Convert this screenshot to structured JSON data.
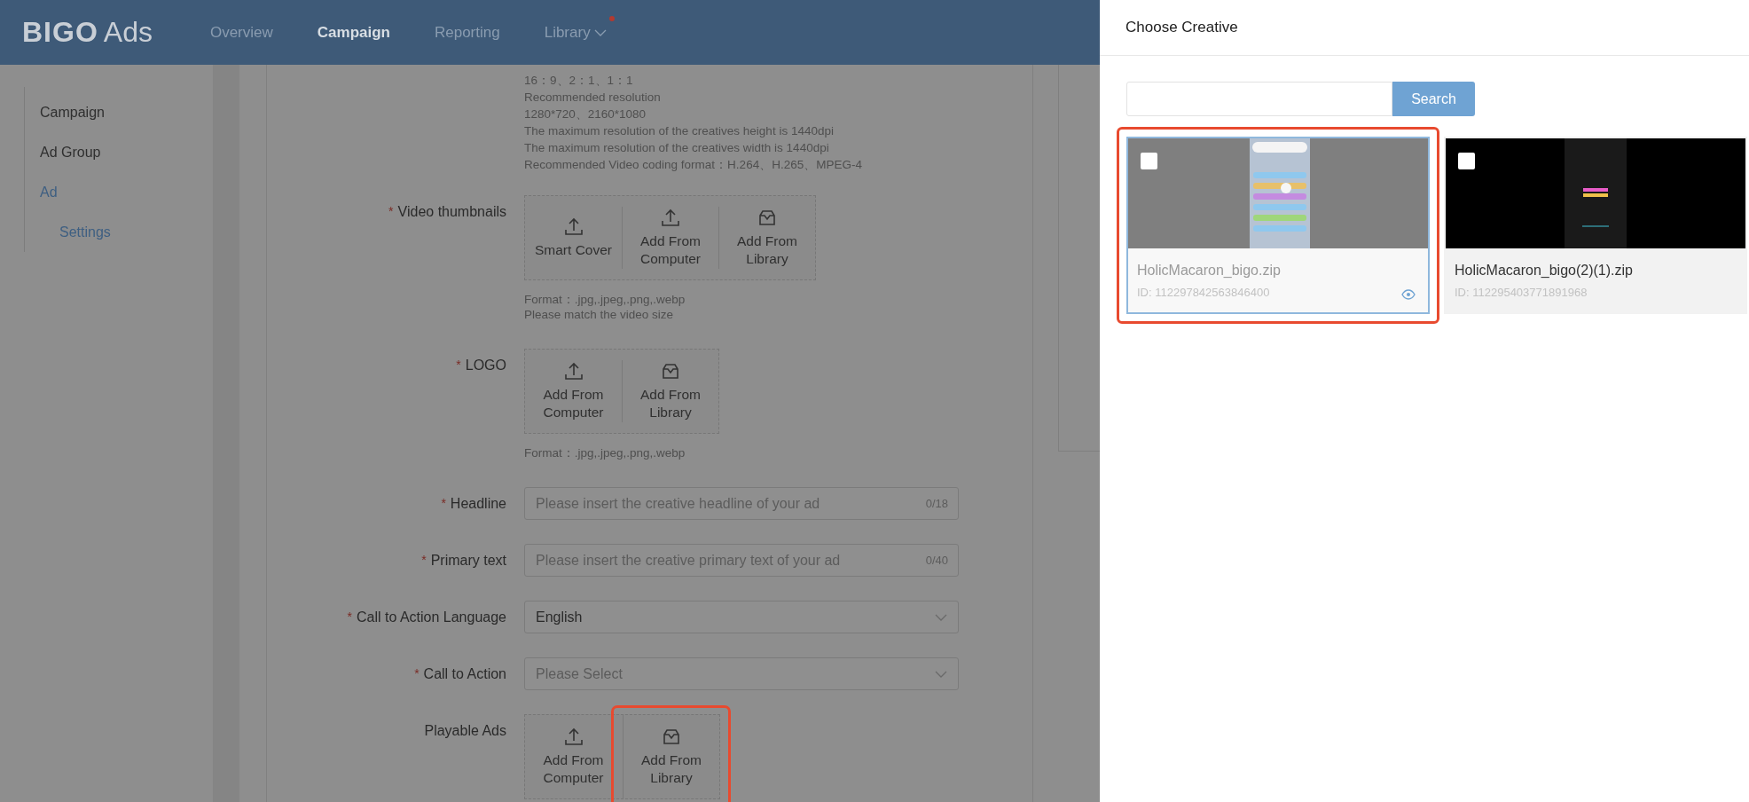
{
  "header": {
    "logo_mark": "BIGO",
    "logo_text": "Ads",
    "nav": [
      {
        "label": "Overview",
        "selected": false,
        "has_menu": false,
        "dot": false
      },
      {
        "label": "Campaign",
        "selected": true,
        "has_menu": false,
        "dot": false
      },
      {
        "label": "Reporting",
        "selected": false,
        "has_menu": false,
        "dot": false
      },
      {
        "label": "Library",
        "selected": false,
        "has_menu": true,
        "dot": true
      }
    ]
  },
  "sidebar": {
    "items": [
      {
        "label": "Campaign",
        "selected": false
      },
      {
        "label": "Ad Group",
        "selected": false
      },
      {
        "label": "Ad",
        "selected": true,
        "children": [
          {
            "label": "Settings",
            "selected": true
          }
        ]
      }
    ]
  },
  "form": {
    "required_mark": "*",
    "spec_lines": [
      "16：9、2：1、1：1",
      "Recommended resolution",
      "1280*720、2160*1080",
      "The maximum resolution of the creatives height is 1440dpi",
      "The maximum resolution of the creatives width is 1440dpi",
      "Recommended Video coding format：H.264、H.265、MPEG-4"
    ],
    "rows": [
      {
        "kind": "upload",
        "label": "Video thumbnails",
        "required": true,
        "options": [
          {
            "kind": "upload",
            "label": "Smart Cover",
            "highlighted": false
          },
          {
            "kind": "upload",
            "label": "Add From Computer",
            "highlighted": false
          },
          {
            "kind": "library",
            "label": "Add From Library",
            "highlighted": false
          }
        ],
        "hints": [
          "Format：.jpg,.jpeg,.png,.webp",
          "Please match the video size"
        ]
      },
      {
        "kind": "upload",
        "label": "LOGO",
        "required": true,
        "options": [
          {
            "kind": "upload",
            "label": "Add From Computer",
            "highlighted": false
          },
          {
            "kind": "library",
            "label": "Add From Library",
            "highlighted": false
          }
        ],
        "hints": [
          "Format：.jpg,.jpeg,.png,.webp"
        ]
      },
      {
        "kind": "input",
        "label": "Headline",
        "required": true,
        "placeholder": "Please insert the creative headline of your ad",
        "counter": "0/18"
      },
      {
        "kind": "input",
        "label": "Primary text",
        "required": true,
        "placeholder": "Please insert the creative primary text of your ad",
        "counter": "0/40"
      },
      {
        "kind": "select",
        "label": "Call to Action Language",
        "required": true,
        "value": "English"
      },
      {
        "kind": "select",
        "label": "Call to Action",
        "required": true,
        "placeholder": "Please Select"
      },
      {
        "kind": "upload",
        "label": "Playable Ads",
        "required": false,
        "options": [
          {
            "kind": "upload",
            "label": "Add From Computer",
            "highlighted": false
          },
          {
            "kind": "library",
            "label": "Add From Library",
            "highlighted": true
          }
        ]
      }
    ]
  },
  "panel": {
    "title": "Choose Creative",
    "search": {
      "button": "Search"
    },
    "creatives": [
      {
        "name": "HolicMacaron_bigo.zip",
        "id": "ID: 112297842563846400",
        "checked": false,
        "selected": true,
        "highlighted": true,
        "preview_icon": true
      },
      {
        "name": "HolicMacaron_bigo(2)(1).zip",
        "id": "ID: 112295403771891968",
        "checked": false,
        "selected": false,
        "highlighted": false,
        "preview_icon": false
      }
    ]
  }
}
